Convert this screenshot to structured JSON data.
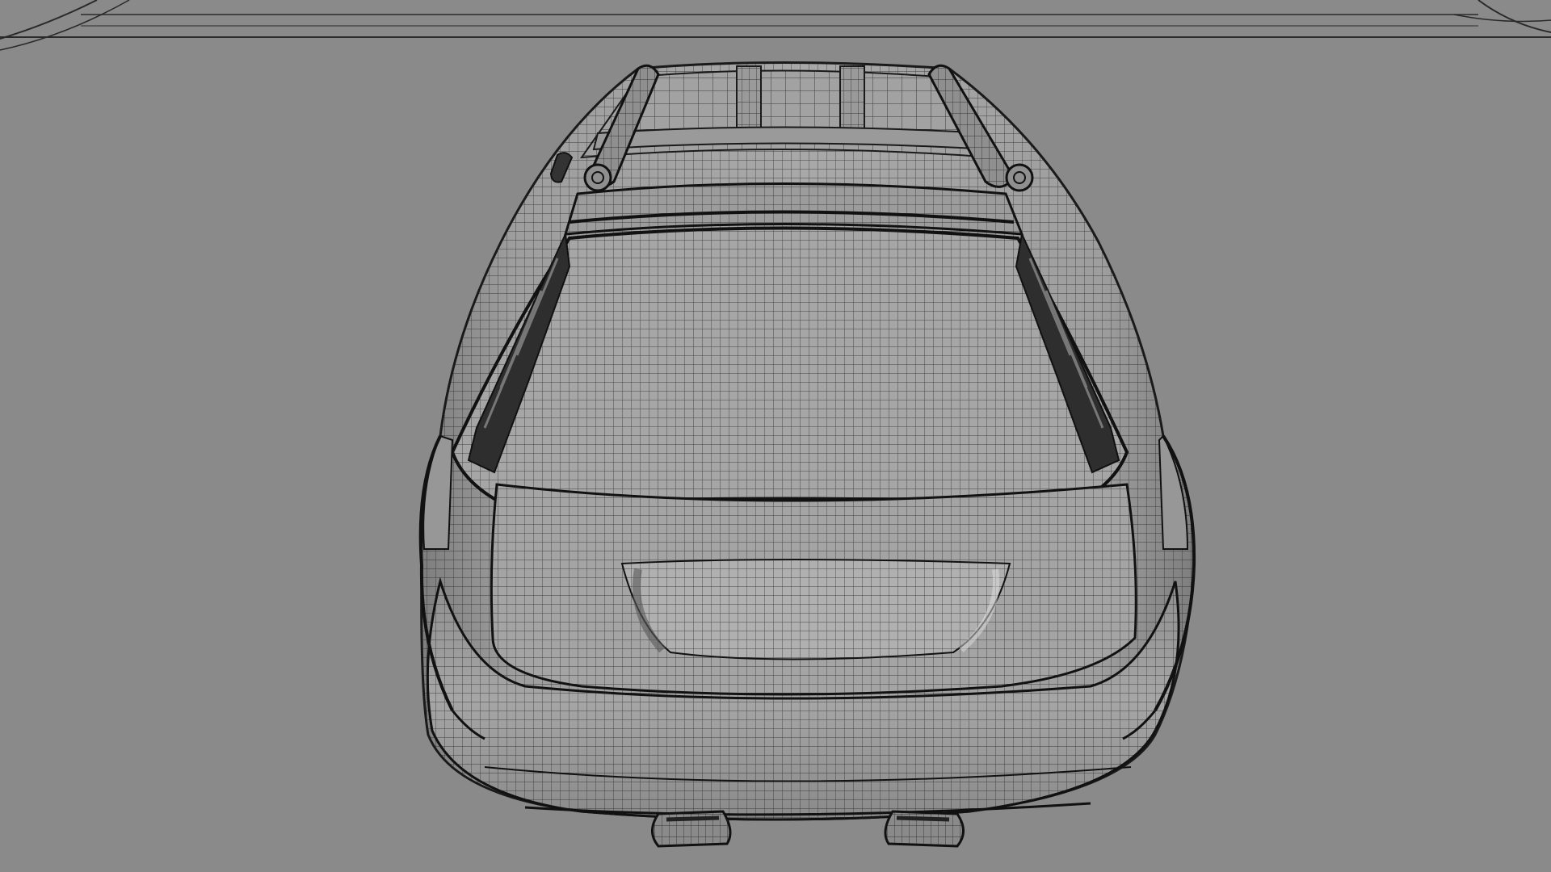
{
  "scene": {
    "subject": "car-wireframe-rear-top-view",
    "colors": {
      "background": "#8a8a8a",
      "body": "#9c9c9c",
      "body_highlight": "#b3b3b3",
      "wire": "#1e1e1e",
      "dark": "#2a2a2a"
    }
  }
}
